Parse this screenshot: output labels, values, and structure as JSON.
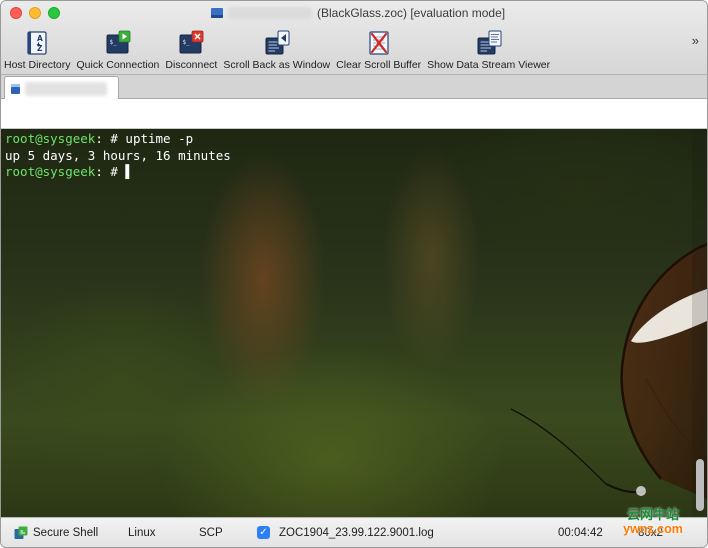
{
  "window": {
    "title": "(BlackGlass.zoc) [evaluation mode]"
  },
  "toolbar": {
    "items": [
      {
        "label": "Host Directory",
        "icon": "address-book-icon"
      },
      {
        "label": "Quick Connection",
        "icon": "terminal-play-icon"
      },
      {
        "label": "Disconnect",
        "icon": "terminal-stop-icon"
      },
      {
        "label": "Scroll Back as Window",
        "icon": "scrollback-window-icon"
      },
      {
        "label": "Clear Scroll Buffer",
        "icon": "clear-buffer-icon"
      },
      {
        "label": "Show Data Stream Viewer",
        "icon": "data-stream-icon"
      }
    ],
    "overflow_glyph": "»"
  },
  "terminal": {
    "lines": [
      {
        "user": "root@sysgeek",
        "rest": ": # ",
        "cmd": "uptime -p"
      },
      {
        "output": "up 5 days, 3 hours, 16 minutes"
      },
      {
        "user": "root@sysgeek",
        "rest": ": # ",
        "cmd": ""
      }
    ],
    "cursor_glyph": "▌"
  },
  "statusbar": {
    "connection": "Secure Shell",
    "emulation": "Linux",
    "transfer": "SCP",
    "log_enabled": true,
    "log_file": "ZOC1904_23.99.122.9001.log",
    "timer": "00:04:42",
    "size": "80x2"
  },
  "watermark": {
    "line1": "云网牛站",
    "line2": "ywnz.com"
  },
  "colors": {
    "prompt_user": "#6ee36a",
    "terminal_text": "#ffffff",
    "check_accent": "#2d7ff5",
    "close": "#ff5f57",
    "minimize": "#febc2e",
    "zoom": "#28c840"
  }
}
